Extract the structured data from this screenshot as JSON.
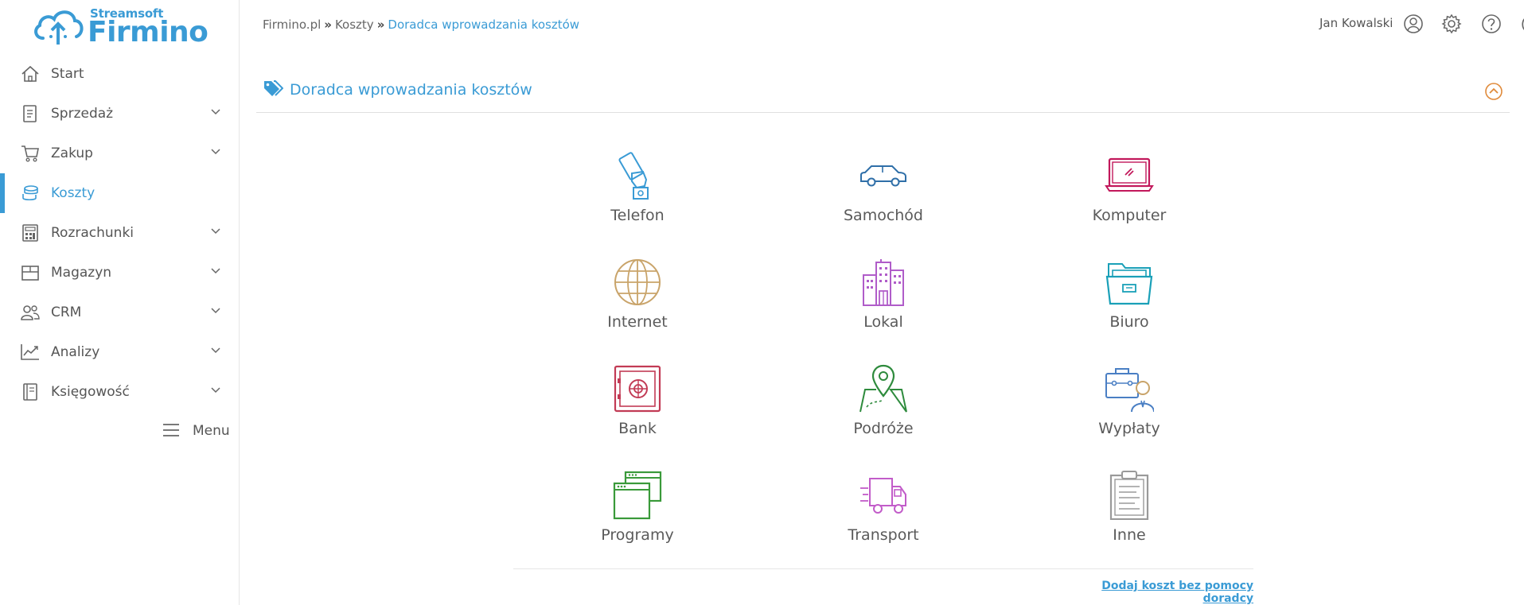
{
  "logo": {
    "top_text": "Streamsoft",
    "main_text": "Firmino"
  },
  "sidebar": {
    "items": [
      {
        "label": "Start",
        "icon": "home-icon",
        "has_submenu": false,
        "active": false
      },
      {
        "label": "Sprzedaż",
        "icon": "invoice-icon",
        "has_submenu": true,
        "active": false
      },
      {
        "label": "Zakup",
        "icon": "cart-icon",
        "has_submenu": true,
        "active": false
      },
      {
        "label": "Koszty",
        "icon": "coins-icon",
        "has_submenu": false,
        "active": true
      },
      {
        "label": "Rozrachunki",
        "icon": "calculator-icon",
        "has_submenu": true,
        "active": false
      },
      {
        "label": "Magazyn",
        "icon": "box-icon",
        "has_submenu": true,
        "active": false
      },
      {
        "label": "CRM",
        "icon": "users-icon",
        "has_submenu": true,
        "active": false
      },
      {
        "label": "Analizy",
        "icon": "chart-icon",
        "has_submenu": true,
        "active": false
      },
      {
        "label": "Księgowość",
        "icon": "book-icon",
        "has_submenu": true,
        "active": false
      }
    ],
    "menu_label": "Menu"
  },
  "breadcrumb": {
    "items": [
      "Firmino.pl",
      "Koszty"
    ],
    "separator": "»",
    "current": "Doradca wprowadzania kosztów"
  },
  "user": {
    "name": "Jan Kowalski"
  },
  "panel": {
    "title": "Doradca wprowadzania kosztów"
  },
  "tiles": [
    {
      "label": "Telefon",
      "icon": "phone-icon",
      "color": "#3a9bd5"
    },
    {
      "label": "Samochód",
      "icon": "car-icon",
      "color": "#2f6fa8"
    },
    {
      "label": "Komputer",
      "icon": "laptop-icon",
      "color": "#c2185b"
    },
    {
      "label": "Internet",
      "icon": "globe-icon",
      "color": "#c9a46a"
    },
    {
      "label": "Lokal",
      "icon": "buildings-icon",
      "color": "#b05cc9"
    },
    {
      "label": "Biuro",
      "icon": "folder-icon",
      "color": "#1aa0b8"
    },
    {
      "label": "Bank",
      "icon": "safe-icon",
      "color": "#c23b55"
    },
    {
      "label": "Podróże",
      "icon": "map-pin-icon",
      "color": "#2e8b3d"
    },
    {
      "label": "Wypłaty",
      "icon": "briefcase-person-icon",
      "color": "#4a7fc4"
    },
    {
      "label": "Programy",
      "icon": "windows-icon",
      "color": "#3a9a3a"
    },
    {
      "label": "Transport",
      "icon": "truck-icon",
      "color": "#c25cc9"
    },
    {
      "label": "Inne",
      "icon": "clipboard-icon",
      "color": "#9a9a9a"
    }
  ],
  "add_link": "Dodaj koszt bez pomocy doradcy",
  "colors": {
    "accent": "#3a9bd5",
    "collapse": "#e08a3a"
  }
}
